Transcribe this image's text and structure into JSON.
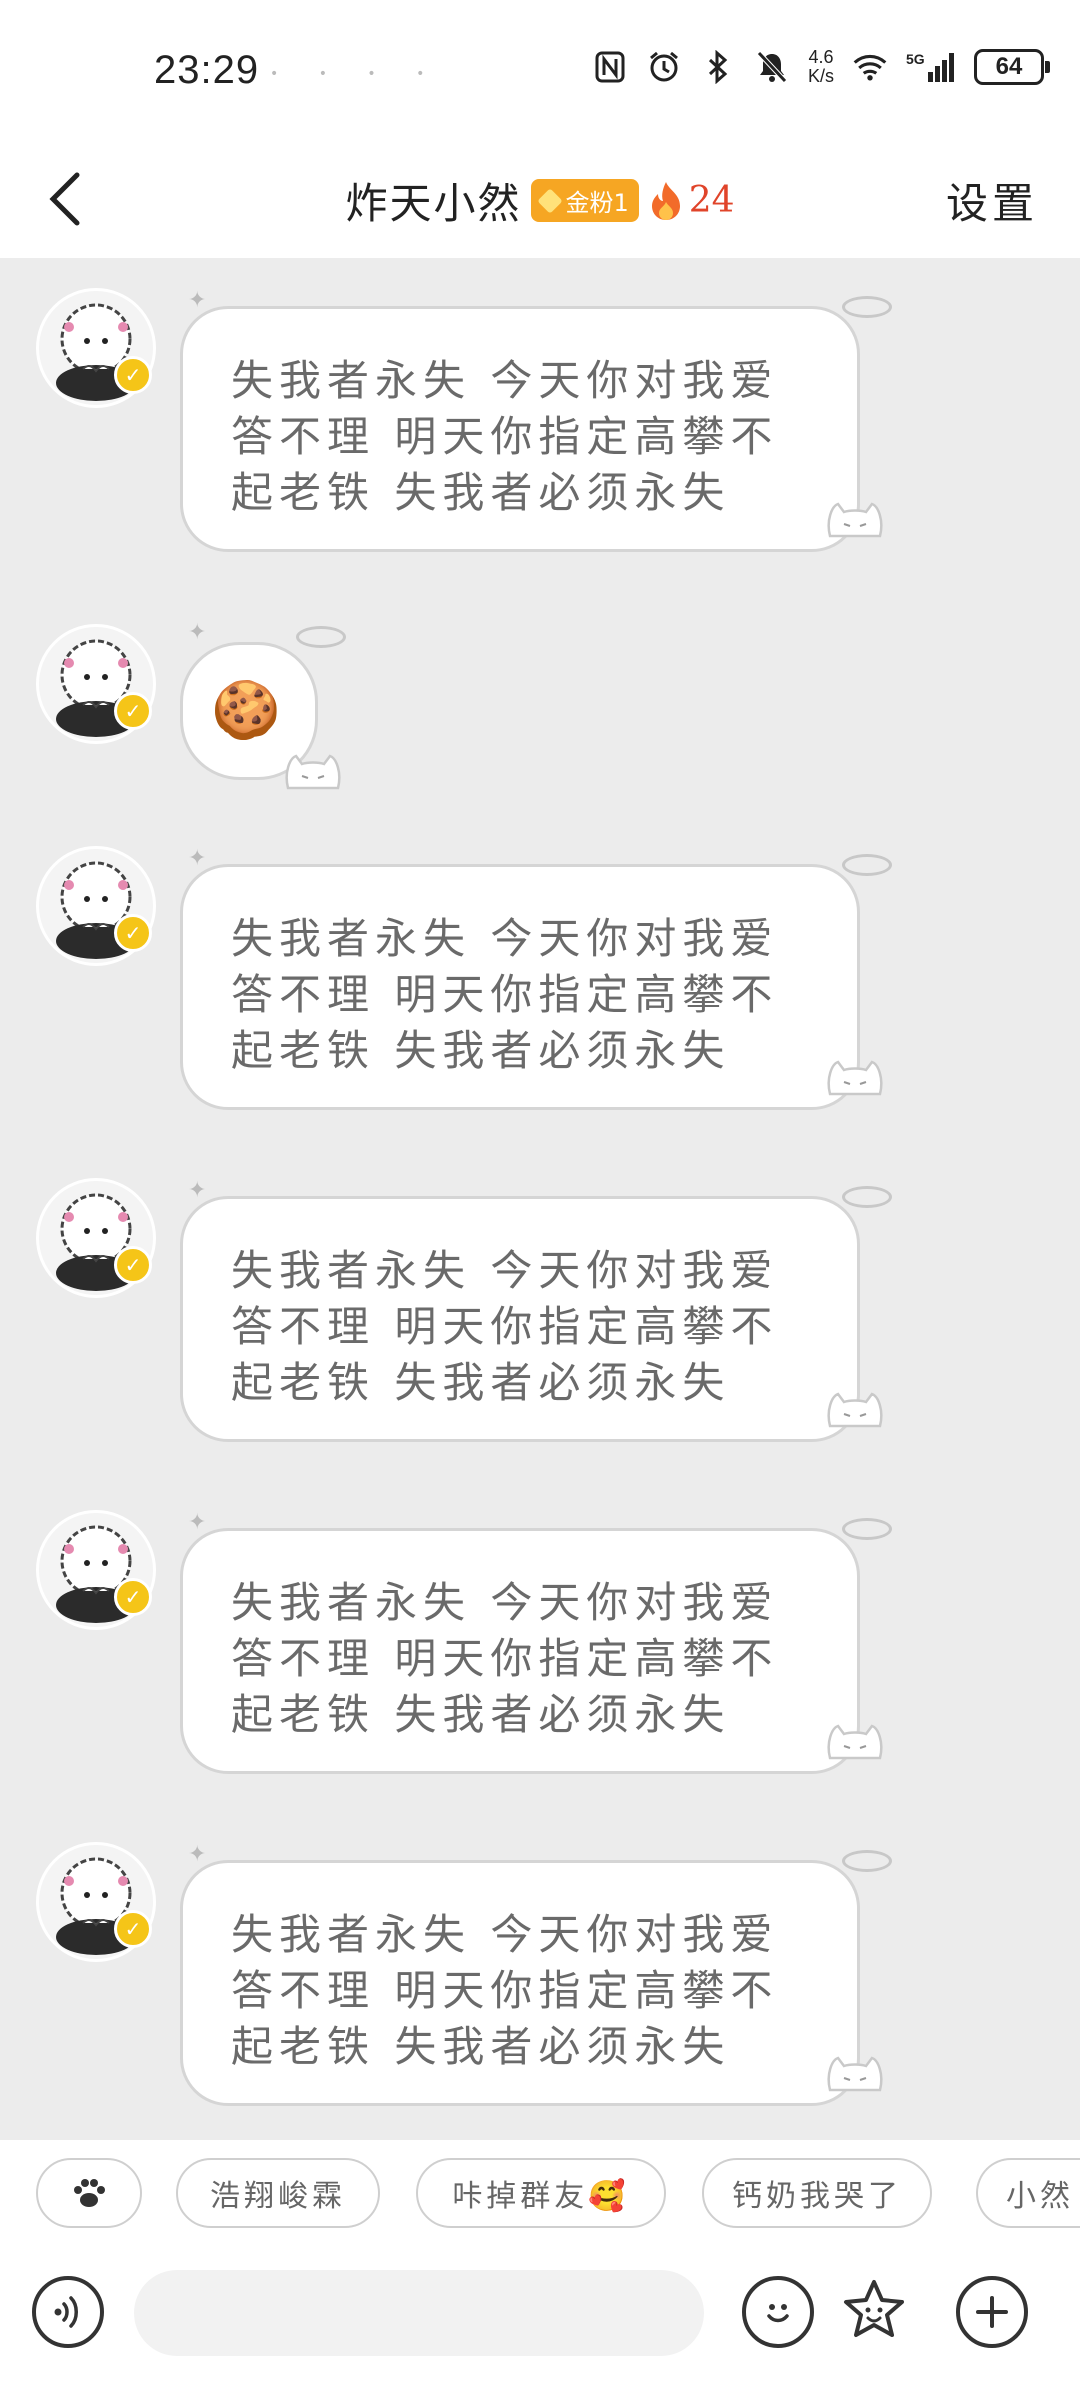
{
  "status_bar": {
    "time": "23:29",
    "net_speed_value": "4.6",
    "net_speed_unit": "K/s",
    "signal": "5G",
    "battery": "64",
    "icons": [
      "nfc-icon",
      "alarm-icon",
      "bluetooth-icon",
      "mute-icon",
      "wifi-icon",
      "cell-signal-icon",
      "battery-icon"
    ]
  },
  "header": {
    "title": "炸天小然",
    "fan_badge": "金粉1",
    "fire_count": "24",
    "settings_label": "设置"
  },
  "messages": [
    {
      "type": "text",
      "text": "失我者永失 今天你对我爱答不理 明天你指定高攀不起老铁 失我者必须永失"
    },
    {
      "type": "emoji",
      "text": "🍪"
    },
    {
      "type": "text",
      "text": "失我者永失 今天你对我爱答不理 明天你指定高攀不起老铁 失我者必须永失"
    },
    {
      "type": "text",
      "text": "失我者永失 今天你对我爱答不理 明天你指定高攀不起老铁 失我者必须永失"
    },
    {
      "type": "text",
      "text": "失我者永失 今天你对我爱答不理 明天你指定高攀不起老铁 失我者必须永失"
    },
    {
      "type": "text",
      "text": "失我者永失 今天你对我爱答不理 明天你指定高攀不起老铁 失我者必须永失"
    }
  ],
  "quick_replies": {
    "paw_icon": "paw-icon",
    "items": [
      "浩翔峻霖",
      "咔掉群友🥰",
      "钙奶我哭了",
      "小然"
    ]
  },
  "input": {
    "value": "",
    "placeholder": ""
  },
  "colors": {
    "chat_bg": "#ececec",
    "bubble_border": "#d5d5d5",
    "badge": "#f6a623",
    "fire": "#e0442a",
    "verified": "#f5c518"
  }
}
